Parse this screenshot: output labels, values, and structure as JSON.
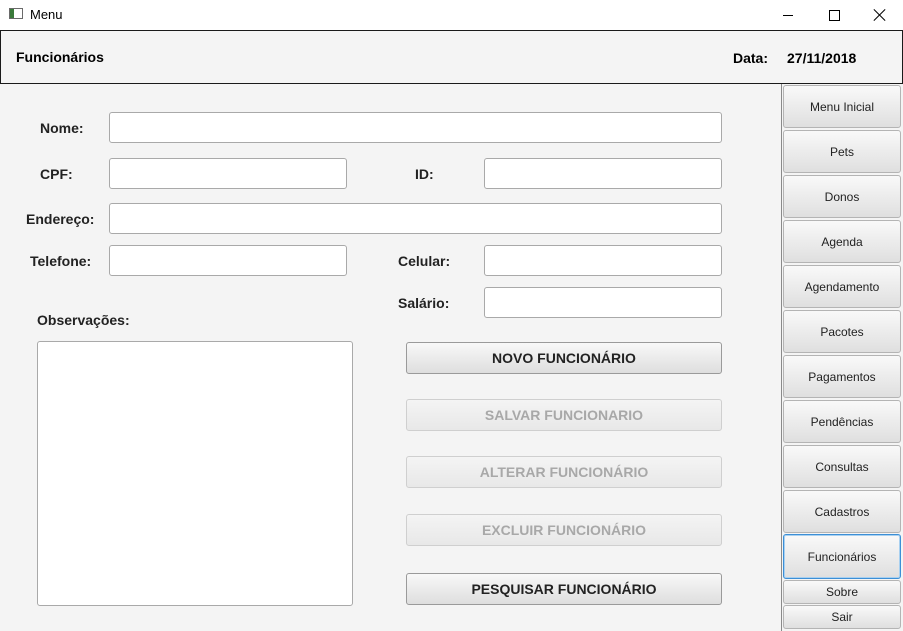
{
  "window": {
    "title": "Menu"
  },
  "header": {
    "title": "Funcionários",
    "date_label": "Data:",
    "date_value": "27/11/2018"
  },
  "form": {
    "nome_label": "Nome:",
    "cpf_label": "CPF:",
    "id_label": "ID:",
    "endereco_label": "Endereço:",
    "telefone_label": "Telefone:",
    "celular_label": "Celular:",
    "salario_label": "Salário:",
    "observacoes_label": "Observações:"
  },
  "buttons": {
    "novo": "NOVO FUNCIONÁRIO",
    "salvar": "SALVAR FUNCIONARIO",
    "alterar": "ALTERAR FUNCIONÁRIO",
    "excluir": "EXCLUIR FUNCIONÁRIO",
    "pesquisar": "PESQUISAR FUNCIONÁRIO"
  },
  "sidebar": {
    "items": [
      {
        "label": "Menu Inicial"
      },
      {
        "label": "Pets"
      },
      {
        "label": "Donos"
      },
      {
        "label": "Agenda"
      },
      {
        "label": "Agendamento"
      },
      {
        "label": "Pacotes"
      },
      {
        "label": "Pagamentos"
      },
      {
        "label": "Pendências"
      },
      {
        "label": "Consultas"
      },
      {
        "label": "Cadastros"
      },
      {
        "label": "Funcionários",
        "active": true
      },
      {
        "label": "Sobre"
      },
      {
        "label": "Sair"
      }
    ]
  },
  "icons": {
    "app": "window-app-icon",
    "minimize": "minimize-icon",
    "maximize": "maximize-icon",
    "close": "close-icon"
  },
  "colors": {
    "active_border": "#3c8fd6",
    "disabled_text": "#a8a8a8"
  }
}
